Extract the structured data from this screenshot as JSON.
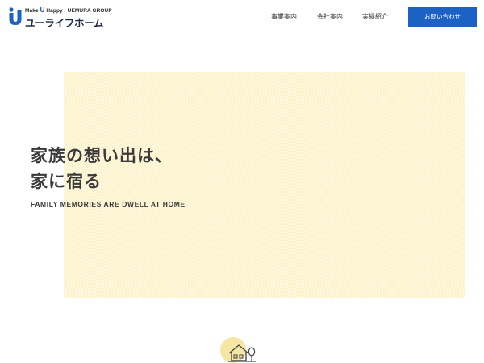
{
  "header": {
    "logo": {
      "tagline_make": "Make",
      "tagline_u": "U",
      "tagline_happy": "Happy",
      "tagline_group": "UEMURA GROUP",
      "brand": "ユーライフホーム"
    },
    "nav": [
      {
        "label": "事業案内"
      },
      {
        "label": "会社案内"
      },
      {
        "label": "実績紹介"
      }
    ],
    "contact_label": "お問い合わせ"
  },
  "hero": {
    "title_line1": "家族の想い出は、",
    "title_line2": "家に宿る",
    "subtitle": "FAMILY MEMORIES ARE DWELL AT HOME"
  },
  "icons": {
    "logo_mark": "u-logo-icon",
    "section_icon": "house-icon"
  },
  "colors": {
    "accent": "#1b62c4",
    "hero_bg": "#fdf1c6",
    "icon_circle": "#f6e6a3",
    "text": "#3a3a3a"
  }
}
